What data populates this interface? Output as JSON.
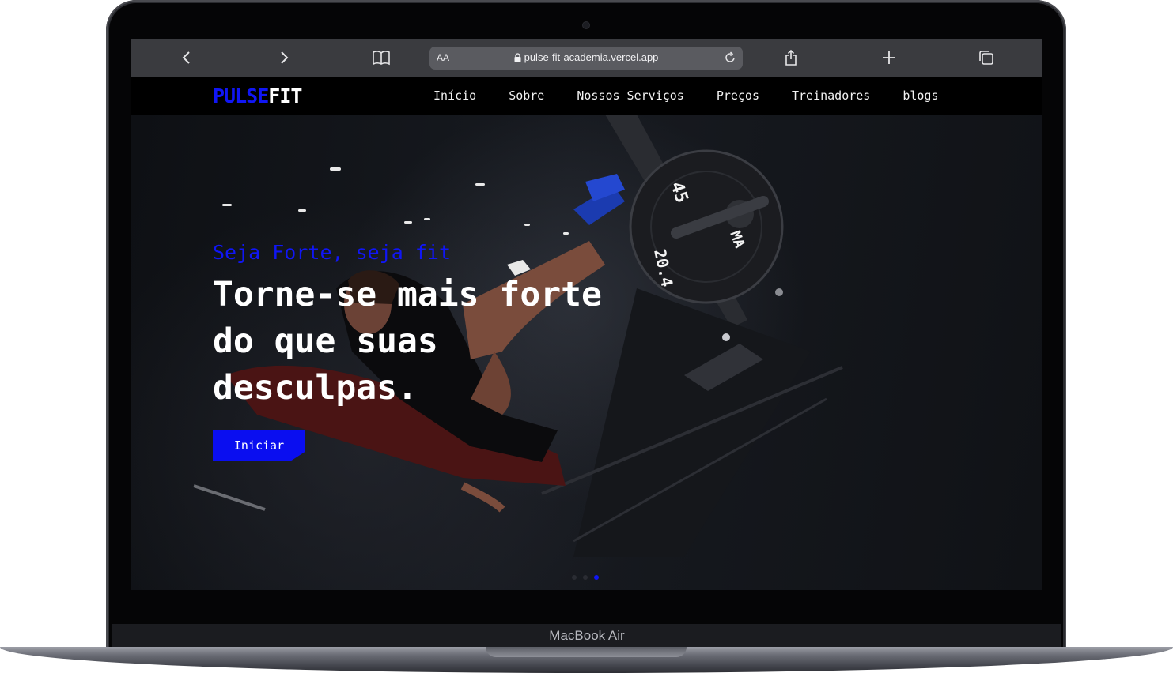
{
  "device": {
    "label": "MacBook Air"
  },
  "browser": {
    "aa_label": "AA",
    "url": "pulse-fit-academia.vercel.app"
  },
  "site": {
    "logo": {
      "part1": "PULSE",
      "part2": "FIT"
    },
    "menu": [
      {
        "label": "Início"
      },
      {
        "label": "Sobre"
      },
      {
        "label": "Nossos Serviços"
      },
      {
        "label": "Preços"
      },
      {
        "label": "Treinadores"
      },
      {
        "label": "blogs"
      }
    ]
  },
  "hero": {
    "tagline": "Seja Forte, seja fit",
    "headline": "Torne-se mais forte do que suas desculpas.",
    "cta_label": "Iniciar",
    "plate_text_1": "45",
    "plate_text_2": "20.4",
    "plate_text_3": "MA",
    "slides_total": 3,
    "slide_active": 3
  },
  "colors": {
    "accent": "#1016f5",
    "nav_bg": "#000000",
    "browser_bar": "#3a3b3f"
  }
}
